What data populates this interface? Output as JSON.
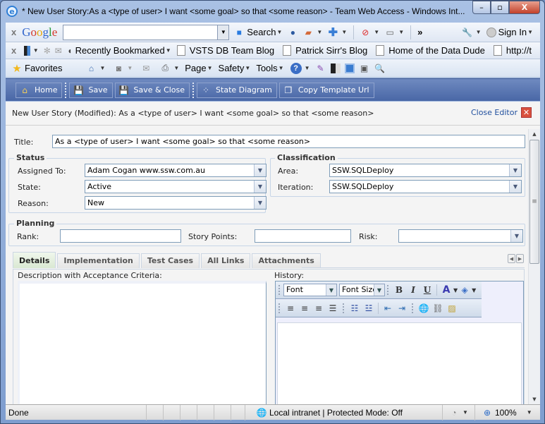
{
  "window": {
    "title": "* New User Story:As a <type of user> I want <some goal> so that <some reason> - Team Web Access - Windows Int...",
    "minimize": "–",
    "maximize": "▫",
    "close": "X"
  },
  "google_bar": {
    "close": "x",
    "logo": [
      "G",
      "o",
      "o",
      "g",
      "l",
      "e"
    ],
    "search_value": "",
    "search_label": "Search",
    "more": "»",
    "sign_in": "Sign In"
  },
  "links_bar": {
    "close": "x",
    "recently_bookmarked": "Recently Bookmarked",
    "bookmarks": [
      "VSTS DB Team Blog",
      "Patrick Sirr's Blog",
      "Home of the Data Dude",
      "http://t"
    ],
    "more": "»"
  },
  "command_bar": {
    "favorites": "Favorites",
    "page": "Page",
    "safety": "Safety",
    "tools": "Tools"
  },
  "app_toolbar": {
    "home": "Home",
    "save": "Save",
    "save_close": "Save & Close",
    "state_diagram": "State Diagram",
    "copy_template_url": "Copy Template Url"
  },
  "editor": {
    "heading": "New User Story (Modified): As a <type of user> I want <some goal> so that <some reason>",
    "close_editor": "Close Editor",
    "title_label": "Title:",
    "title_value": "As a <type of user> I want <some goal> so that <some reason>",
    "status": {
      "legend": "Status",
      "assigned_to_label": "Assigned To:",
      "assigned_to_value": "Adam Cogan www.ssw.com.au",
      "state_label": "State:",
      "state_value": "Active",
      "reason_label": "Reason:",
      "reason_value": "New"
    },
    "classification": {
      "legend": "Classification",
      "area_label": "Area:",
      "area_value": "SSW.SQLDeploy",
      "iteration_label": "Iteration:",
      "iteration_value": "SSW.SQLDeploy"
    },
    "planning": {
      "legend": "Planning",
      "rank_label": "Rank:",
      "rank_value": "",
      "story_points_label": "Story Points:",
      "story_points_value": "",
      "risk_label": "Risk:",
      "risk_value": ""
    },
    "tabs": [
      "Details",
      "Implementation",
      "Test Cases",
      "All Links",
      "Attachments"
    ],
    "active_tab": "Details",
    "description_label": "Description with Acceptance Criteria:",
    "description_value": "",
    "history_label": "History:",
    "history_value": "",
    "rte": {
      "font": "Font",
      "font_size": "Font Size",
      "bold": "B",
      "italic": "I",
      "underline": "U"
    }
  },
  "status_bar": {
    "status": "Done",
    "zone": "Local intranet | Protected Mode: Off",
    "zoom": "100%"
  }
}
